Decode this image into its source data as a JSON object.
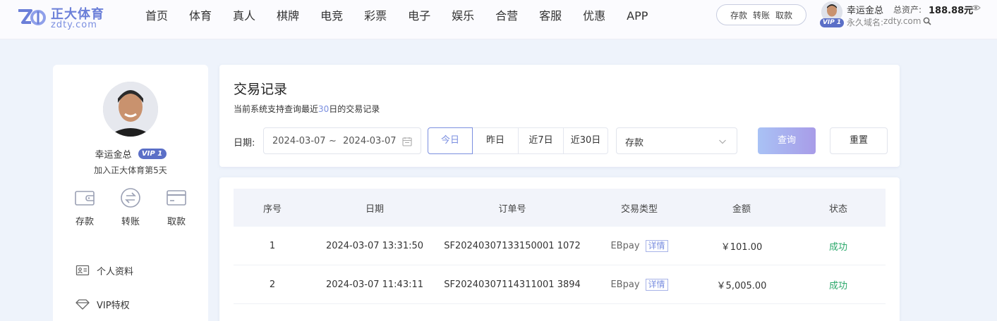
{
  "brand": {
    "name": "正大体育",
    "domain": "zdty.com",
    "accent_color": "#6b7fd8"
  },
  "nav": {
    "items": [
      "首页",
      "体育",
      "真人",
      "棋牌",
      "电竞",
      "彩票",
      "电子",
      "娱乐",
      "合营",
      "客服",
      "优惠",
      "APP"
    ]
  },
  "quick_actions": {
    "deposit": "存款",
    "transfer": "转账",
    "withdraw": "取款"
  },
  "user_header": {
    "vip": "VIP 1",
    "name": "幸运金总",
    "assets_label": "总资产:",
    "assets_value": "188.88元",
    "domain_label": "永久域名:",
    "domain_value": "zdty.com"
  },
  "sidebar": {
    "name": "幸运金总",
    "vip": "VIP 1",
    "join_text": "加入正大体育第5天",
    "actions": [
      {
        "label": "存款",
        "icon": "wallet-icon"
      },
      {
        "label": "转账",
        "icon": "transfer-icon"
      },
      {
        "label": "取款",
        "icon": "card-icon"
      }
    ],
    "menu": [
      {
        "label": "个人资料",
        "icon": "id-card-icon"
      },
      {
        "label": "VIP特权",
        "icon": "diamond-icon"
      }
    ]
  },
  "filter": {
    "title": "交易记录",
    "subtitle_prefix": "当前系统支持查询最近",
    "subtitle_days": "30",
    "subtitle_suffix": "日的交易记录",
    "date_label": "日期:",
    "date_start": "2024-03-07",
    "date_sep": "~",
    "date_end": "2024-03-07",
    "quick_ranges": [
      "今日",
      "昨日",
      "近7日",
      "近30日"
    ],
    "active_range": "今日",
    "type_selected": "存款",
    "query_label": "查询",
    "reset_label": "重置"
  },
  "table": {
    "headers": [
      "序号",
      "日期",
      "订单号",
      "交易类型",
      "金额",
      "状态"
    ],
    "detail_label": "详情",
    "rows": [
      {
        "index": "1",
        "date": "2024-03-07 13:31:50",
        "order": "SF20240307133150001 1072",
        "type": "EBpay",
        "amount": "￥101.00",
        "status": "成功"
      },
      {
        "index": "2",
        "date": "2024-03-07 11:43:11",
        "order": "SF20240307114311001 3894",
        "type": "EBpay",
        "amount": "￥5,005.00",
        "status": "成功"
      }
    ]
  }
}
